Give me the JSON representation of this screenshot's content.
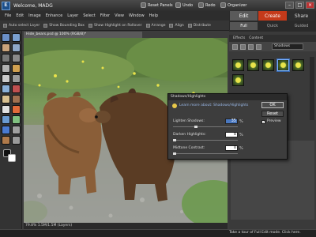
{
  "app": {
    "logo": "E",
    "title": "Welcome, MADG"
  },
  "titlebar": {
    "reset_panels": "Reset Panels",
    "undo": "Undo",
    "redo": "Redo",
    "organizer": "Organizer"
  },
  "menu": [
    "File",
    "Edit",
    "Image",
    "Enhance",
    "Layer",
    "Select",
    "Filter",
    "View",
    "Window",
    "Help"
  ],
  "modes": {
    "tabs": [
      "Edit",
      "Create",
      "Share"
    ],
    "active_tab": "Edit",
    "subtabs": [
      "Full",
      "Quick",
      "Guided"
    ],
    "active_subtab": "Full"
  },
  "options_bar": [
    "Auto select Layer",
    "Show Bounding Box",
    "Show Highlight on Rollover",
    "Arrange",
    "Align",
    "Distribute"
  ],
  "document_tab": "Hide_bears.psd @ 100% (RGB/8)*",
  "status": "79.8%  1.5M/1.5M (Layers)",
  "panel": {
    "tabs": [
      "Effects",
      "Content"
    ],
    "dropdown": "Shadows",
    "bottom_text": "Take a tour of Full Edit mode. Click here."
  },
  "dialog": {
    "title": "Shadows/Highlights",
    "learn_more": "Learn more about: Shadows/Highlights",
    "ok": "OK",
    "reset": "Reset",
    "preview_label": "Preview",
    "preview_checked": true,
    "sliders": [
      {
        "label": "Lighten Shadows:",
        "value": 35,
        "unit": "%"
      },
      {
        "label": "Darken Highlights:",
        "value": 0,
        "unit": "%"
      },
      {
        "label": "Midtone Contrast:",
        "value": 0,
        "unit": "%"
      }
    ]
  },
  "colors": {
    "accent": "#3a6ab0",
    "close": "#bb3333",
    "highlight": "#7ab0ff"
  }
}
